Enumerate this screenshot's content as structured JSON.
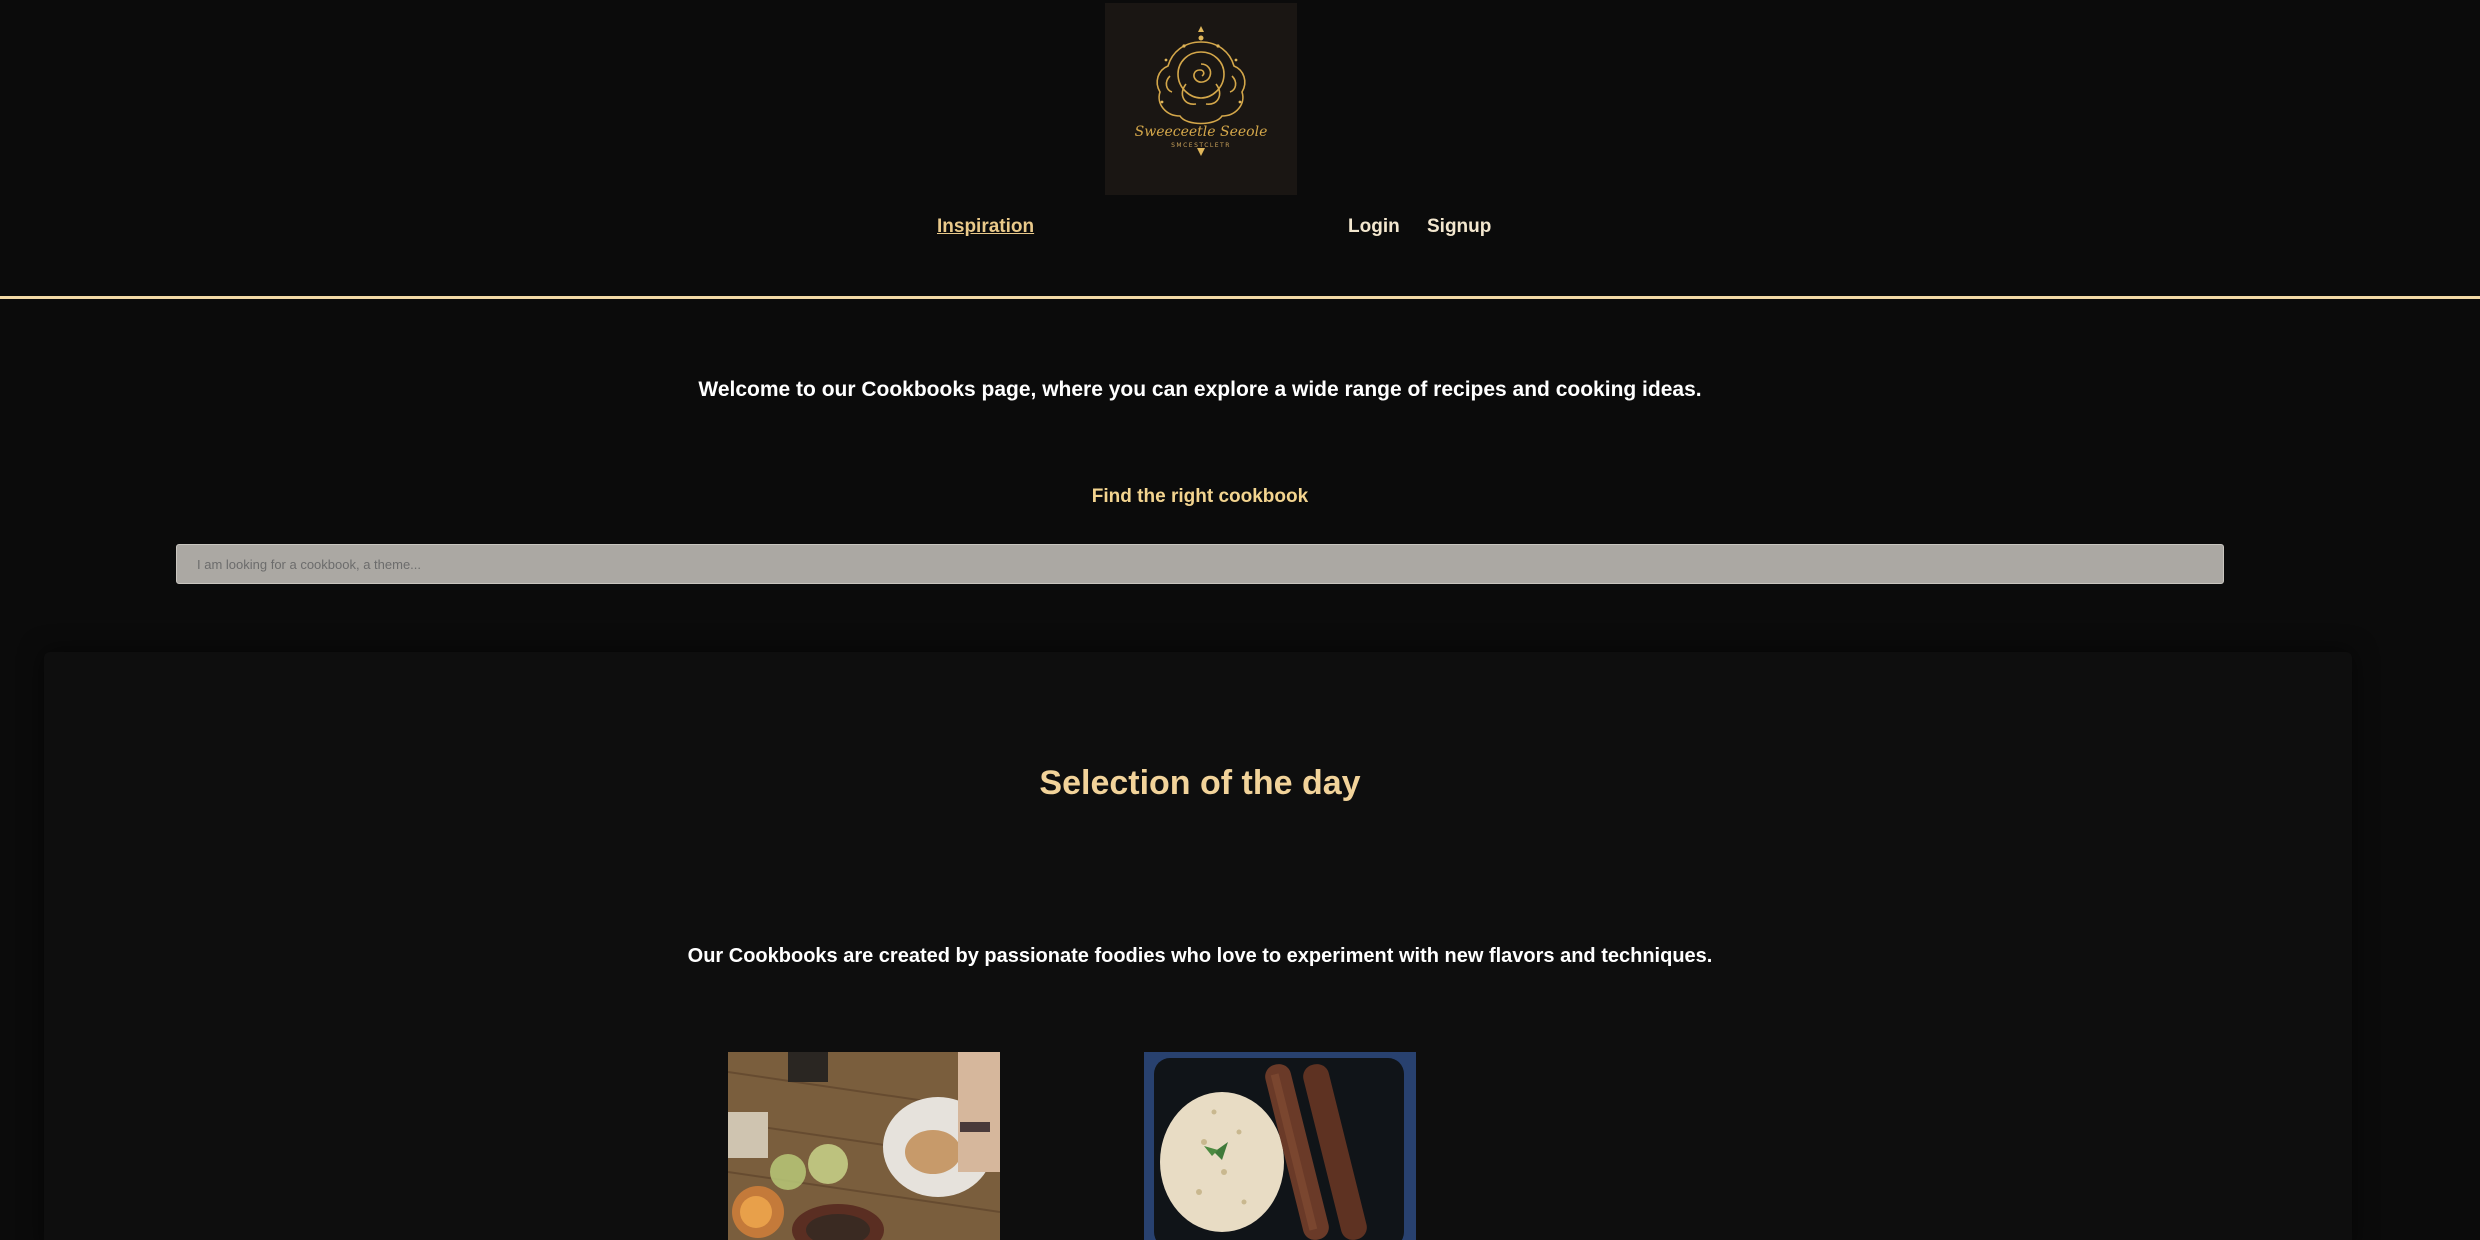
{
  "header": {
    "logo": {
      "script_text": "Sweeceetle Seeole",
      "sub_text": "SMCESTCLETR",
      "accent_color": "#d4a74a"
    },
    "nav": {
      "inspiration": "Inspiration",
      "login": "Login",
      "signup": "Signup"
    },
    "rule_color": "#f2d9a6"
  },
  "intro": {
    "welcome_text": "Welcome to our Cookbooks page, where you can explore a wide range of recipes and cooking ideas.",
    "find_title": "Find the right cookbook",
    "search_placeholder": "I am looking for a cookbook, a theme..."
  },
  "selection": {
    "title": "Selection of the day",
    "description": "Our Cookbooks are created by passionate foodies who love to experiment with new flavors and techniques.",
    "cards": [
      {
        "image": "table-meal-photo"
      },
      {
        "image": "kebab-rice-photo"
      }
    ]
  },
  "colors": {
    "background": "#0b0b0b",
    "accent": "#f3d48f",
    "text": "#ffffff"
  }
}
